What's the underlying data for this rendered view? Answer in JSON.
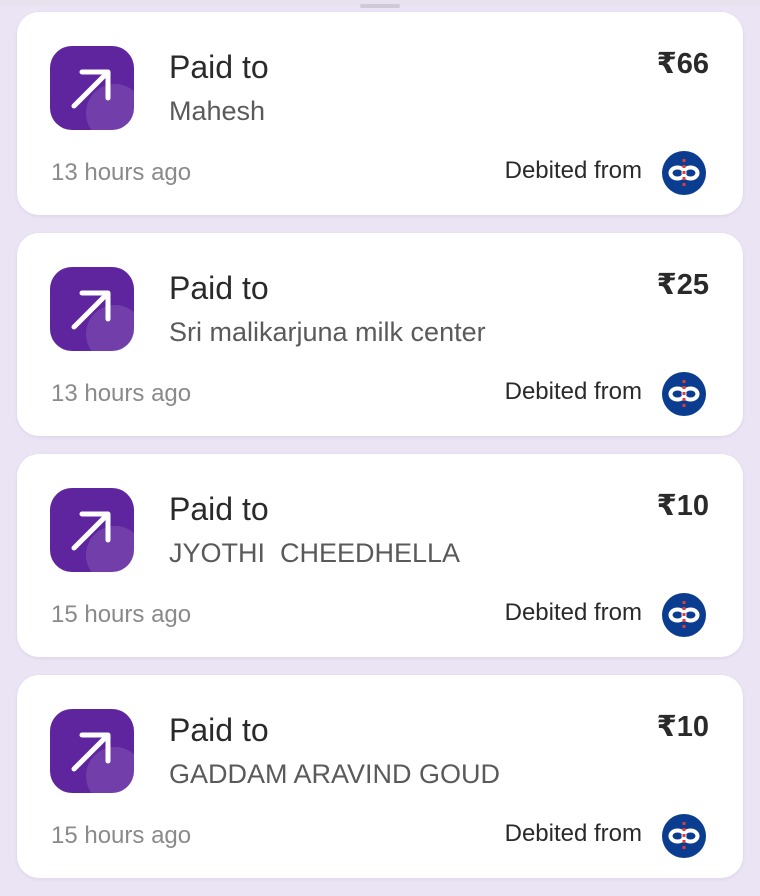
{
  "theme": {
    "accent": "#5f259f",
    "background": "#ebe4f5",
    "bank_blue": "#0a3d8f",
    "bank_red": "#e23b3b"
  },
  "transactions": [
    {
      "direction_icon": "arrow-up-right-icon",
      "title": "Paid to",
      "payee": "Mahesh",
      "amount": "₹66",
      "time": "13 hours ago",
      "debited_label": "Debited from",
      "bank_icon": "bank-logo-icon"
    },
    {
      "direction_icon": "arrow-up-right-icon",
      "title": "Paid to",
      "payee": "Sri malikarjuna milk center",
      "amount": "₹25",
      "time": "13 hours ago",
      "debited_label": "Debited from",
      "bank_icon": "bank-logo-icon"
    },
    {
      "direction_icon": "arrow-up-right-icon",
      "title": "Paid to",
      "payee": "JYOTHI  CHEEDHELLA",
      "amount": "₹10",
      "time": "15 hours ago",
      "debited_label": "Debited from",
      "bank_icon": "bank-logo-icon"
    },
    {
      "direction_icon": "arrow-up-right-icon",
      "title": "Paid to",
      "payee": "GADDAM ARAVIND GOUD",
      "amount": "₹10",
      "time": "15 hours ago",
      "debited_label": "Debited from",
      "bank_icon": "bank-logo-icon"
    }
  ]
}
